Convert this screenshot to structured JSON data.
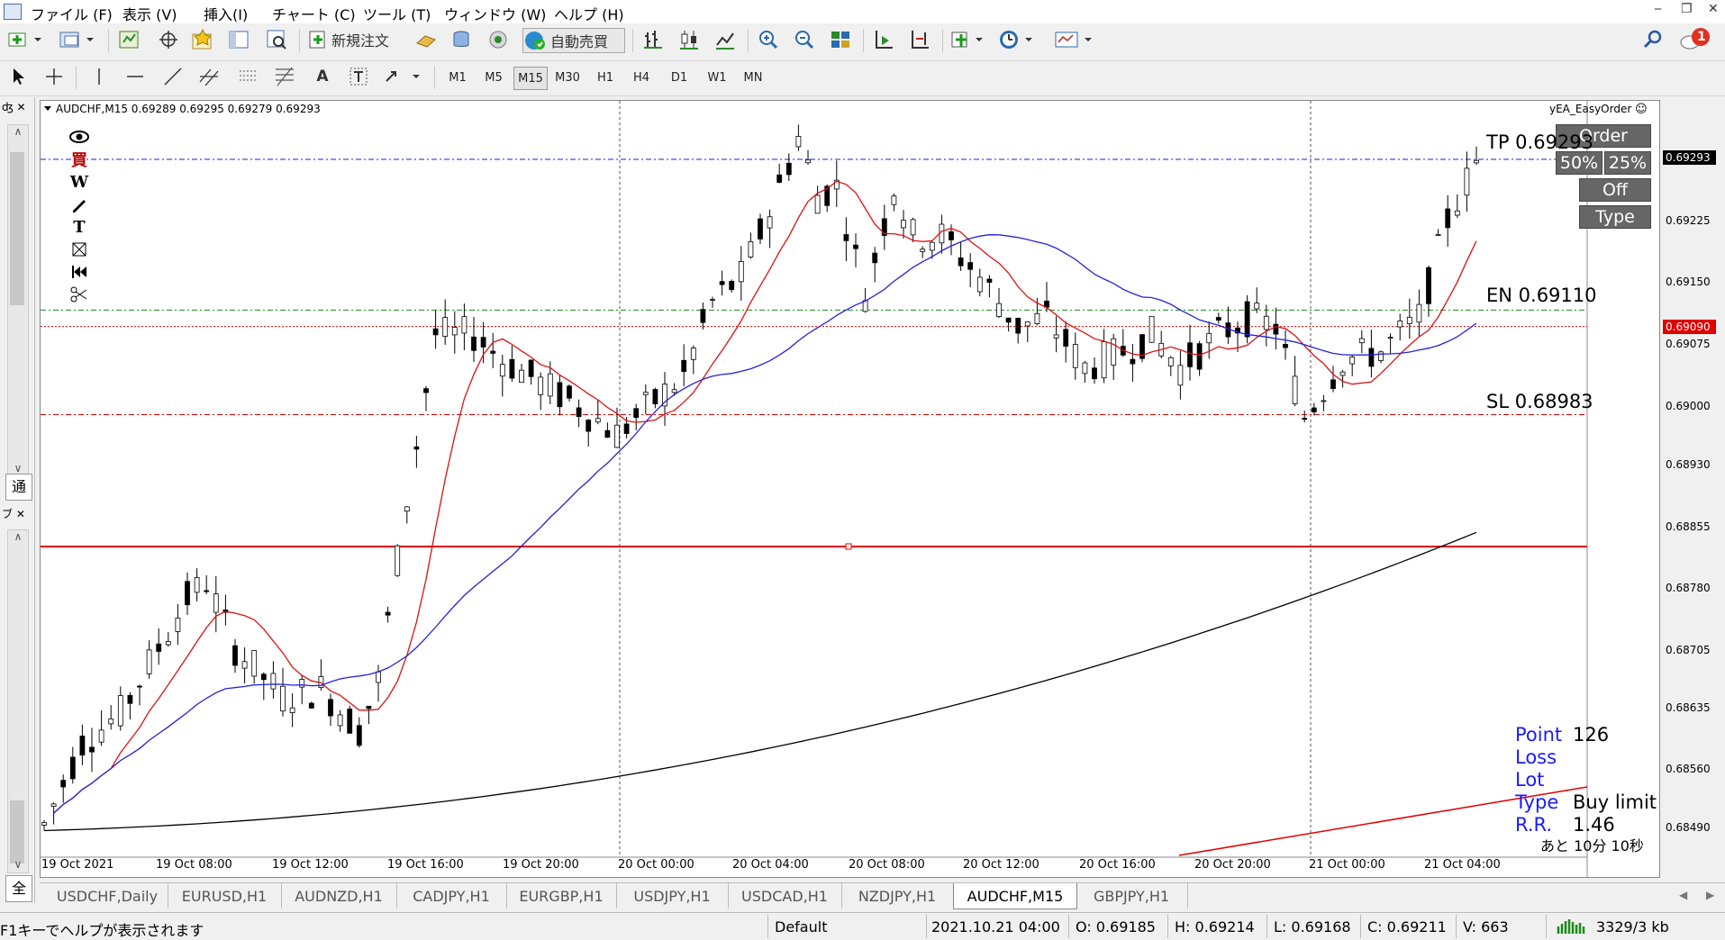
{
  "menu": [
    "ファイル (F)",
    "表示 (V)",
    "挿入(I)",
    "チャート (C)",
    "ツール (T)",
    "ウィンドウ (W)",
    "ヘルプ (H)"
  ],
  "toolbar": {
    "new_order_label": "新規注文",
    "auto_trade_label": "自動売買",
    "notification_count": "1"
  },
  "timeframes": [
    "M1",
    "M5",
    "M15",
    "M30",
    "H1",
    "H4",
    "D1",
    "W1",
    "MN"
  ],
  "active_timeframe": "M15",
  "chart": {
    "header": "AUDCHF,M15  0.69289 0.69295 0.69279 0.69293",
    "ea_name": "yEA_EasyOrder",
    "current_price": "0.69293",
    "pending_price": "0.69090",
    "price_ticks": [
      "0.69225",
      "0.69150",
      "0.69075",
      "0.69000",
      "0.68930",
      "0.68855",
      "0.68780",
      "0.68705",
      "0.68635",
      "0.68560",
      "0.68490"
    ],
    "time_ticks": [
      "19 Oct 2021",
      "19 Oct 08:00",
      "19 Oct 12:00",
      "19 Oct 16:00",
      "19 Oct 20:00",
      "20 Oct 00:00",
      "20 Oct 04:00",
      "20 Oct 08:00",
      "20 Oct 12:00",
      "20 Oct 16:00",
      "20 Oct 20:00",
      "21 Oct 00:00",
      "21 Oct 04:00"
    ],
    "tp_label": "TP  0.69293",
    "en_label": "EN  0.69110",
    "sl_label": "SL  0.68983",
    "colors": {
      "tp": "#1a1aff",
      "en": "#1a8a1a",
      "sl": "#e00000",
      "ma_fast": "#e01010",
      "ma_mid": "#2222dd",
      "ma_slow": "#000000"
    }
  },
  "ea_panel": {
    "order": "Order",
    "pct50": "50%",
    "pct25": "25%",
    "off": "Off",
    "type": "Type"
  },
  "info": {
    "point_label": "Point",
    "point_value": "126",
    "loss_label": "Loss",
    "lot_label": "Lot",
    "type_label": "Type",
    "type_value": "Buy limit",
    "rr_label": "R.R.",
    "rr_value": "1.46",
    "timer": "あと 10分 10秒"
  },
  "chart_tools": [
    "eye-icon",
    "buy-icon",
    "w-icon",
    "pen-icon",
    "text-icon",
    "box-icon",
    "rewind-icon",
    "scissors-icon"
  ],
  "dock": {
    "tab1": "通",
    "tab2": "全"
  },
  "tabs": [
    "USDCHF,Daily",
    "EURUSD,H1",
    "AUDNZD,H1",
    "CADJPY,H1",
    "EURGBP,H1",
    "USDJPY,H1",
    "USDCAD,H1",
    "NZDJPY,H1",
    "AUDCHF,M15",
    "GBPJPY,H1"
  ],
  "active_tab": "AUDCHF,M15",
  "status": {
    "help": "F1キーでヘルプが表示されます",
    "profile": "Default",
    "datetime": "2021.10.21 04:00",
    "open": "O: 0.69185",
    "high": "H: 0.69214",
    "low": "L: 0.69168",
    "close": "C: 0.69211",
    "volume": "V: 663",
    "traffic": "3329/3 kb"
  }
}
